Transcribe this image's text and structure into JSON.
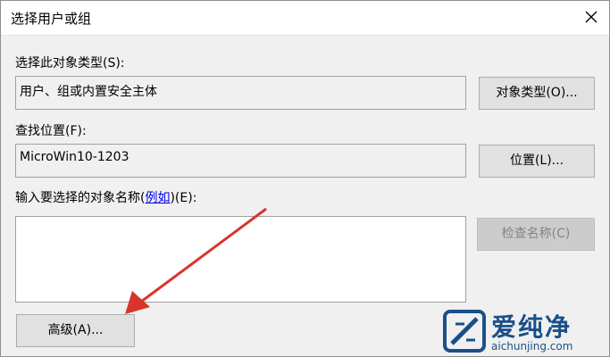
{
  "window": {
    "title": "选择用户或组"
  },
  "object_type": {
    "label": "选择此对象类型(S):",
    "value": "用户、组或内置安全主体",
    "button_label": "对象类型(O)..."
  },
  "location": {
    "label": "查找位置(F):",
    "value": "MicroWin10-1203",
    "button_label": "位置(L)..."
  },
  "names": {
    "label_prefix": "输入要选择的对象名称(",
    "label_link": "例如",
    "label_suffix": ")(E):",
    "value": "",
    "check_button_label": "检查名称(C)"
  },
  "advanced_button_label": "高级(A)...",
  "watermark": {
    "title": "爱纯净",
    "url": "aichunjing.com"
  },
  "colors": {
    "arrow": "#d9342b",
    "watermark": "#1a4f8a"
  },
  "icons": {
    "close": "close-icon",
    "arrow": "red-arrow-annotation",
    "logo": "aichunjing-logo-icon"
  }
}
